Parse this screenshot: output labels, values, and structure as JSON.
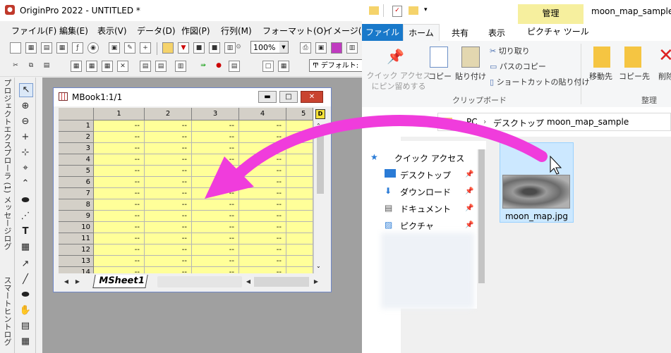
{
  "origin": {
    "title": "OriginPro 2022 - UNTITLED *",
    "menus": [
      "ファイル(F)",
      "編集(E)",
      "表示(V)",
      "データ(D)",
      "作図(P)",
      "行列(M)",
      "フォーマット(O)",
      "イメージ(I)"
    ],
    "zoom": "100%",
    "font_name": "デフォルト:",
    "side_panes": [
      "プロジェクトエクスプローラ (1)",
      "メッセージログ",
      "スマートヒントログ"
    ],
    "workbook": {
      "title": "MBook1:1/1",
      "columns": [
        "1",
        "2",
        "3",
        "4",
        "5"
      ],
      "rows": [
        "1",
        "2",
        "3",
        "4",
        "5",
        "6",
        "7",
        "8",
        "9",
        "10",
        "11",
        "12",
        "13",
        "14"
      ],
      "cell_value": "--",
      "sheet_tab": "MSheet1"
    }
  },
  "explorer": {
    "title": "moon_map_sample",
    "context_tab": "管理",
    "tabs": [
      "ファイル",
      "ホーム",
      "共有",
      "表示",
      "ピクチャ ツール"
    ],
    "ribbon": {
      "quick_access": "クイック アクセス\nにピン留めする",
      "copy": "コピー",
      "paste": "貼り付け",
      "cut": "切り取り",
      "copy_path": "パスのコピー",
      "paste_shortcut": "ショートカットの貼り付け",
      "group_clipboard": "クリップボード",
      "move_to": "移動先",
      "copy_to": "コピー先",
      "delete": "削除",
      "group_organize": "整理"
    },
    "breadcrumb": [
      "PC",
      "デスクトップ",
      "moon_map_sample"
    ],
    "nav": [
      {
        "label": "クイック アクセス",
        "icon": "star-icon"
      },
      {
        "label": "デスクトップ",
        "icon": "desktop-icon"
      },
      {
        "label": "ダウンロード",
        "icon": "download-icon"
      },
      {
        "label": "ドキュメント",
        "icon": "document-icon"
      },
      {
        "label": "ピクチャ",
        "icon": "picture-icon"
      }
    ],
    "file": {
      "name": "moon_map.jpg"
    }
  },
  "colors": {
    "arrow": "#f03cdc",
    "grid": "#ffff99",
    "file_tab": "#1979ca",
    "manage": "#f6ef9e"
  }
}
